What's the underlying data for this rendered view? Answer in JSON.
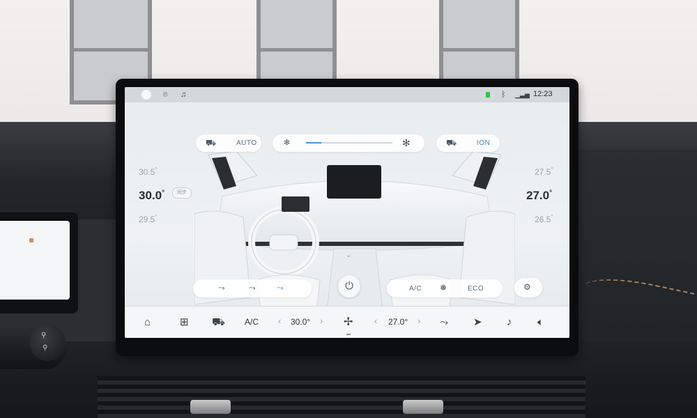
{
  "status_bar": {
    "time": "12:23",
    "icons": [
      "avatar-icon",
      "location-icon",
      "notification-icon",
      "signal-green-indicator",
      "bluetooth-icon",
      "cellular-signal-icon"
    ]
  },
  "climate": {
    "left_mode_label": "AUTO",
    "right_mode_label": "ION",
    "fan_level": 0.18,
    "left_temp_above": "30.5",
    "left_temp": "30.0",
    "left_temp_below": "29.5",
    "right_temp_above": "27.5",
    "right_temp": "27.0",
    "right_temp_below": "26.5",
    "degree": "°",
    "sync_chip": "同步",
    "bottom_right_buttons": [
      "A/C",
      "ECO"
    ]
  },
  "dock": {
    "ac_label": "A/C",
    "left_temp": "30.0°",
    "right_temp": "27.0°",
    "icons": [
      "home-icon",
      "apps-grid-icon",
      "car-icon",
      "fan-icon",
      "seat-heat-icon",
      "navigation-icon",
      "music-icon",
      "volume-icon"
    ]
  },
  "colors": {
    "accent_blue": "#4d8fd6",
    "status_green": "#35c24e"
  }
}
